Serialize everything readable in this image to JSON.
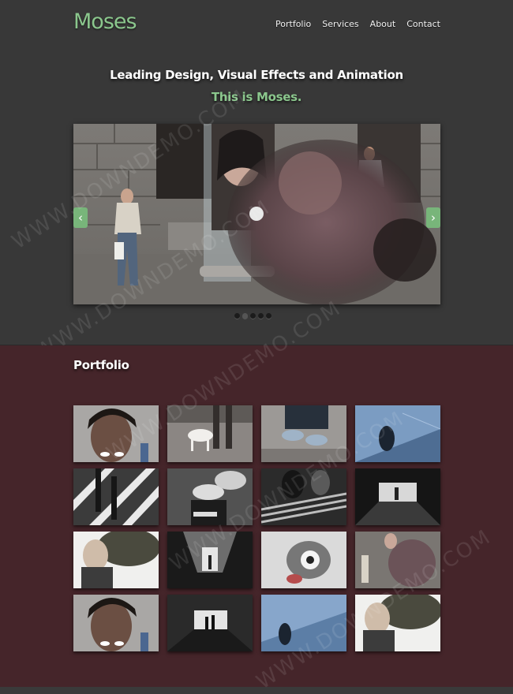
{
  "header": {
    "logo": "Moses",
    "nav": [
      "Portfolio",
      "Services",
      "About",
      "Contact"
    ]
  },
  "hero": {
    "headline": "Leading Design, Visual Effects and Animation",
    "tagline": "This is Moses."
  },
  "slider": {
    "prev_glyph": "‹",
    "next_glyph": "›",
    "dot_count": 5,
    "active_dot": 1
  },
  "portfolio": {
    "title": "Portfolio",
    "items": [
      "portrait-face",
      "legs-dog",
      "shoes-street",
      "blue-tunnel",
      "crosswalk-legs",
      "hand-cup",
      "stairs-crowd",
      "dark-tunnel",
      "tree-woman",
      "light-corridor",
      "badge-hand",
      "street-blur",
      "portrait-face",
      "station-silhouette",
      "blue-figure",
      "tree-woman"
    ]
  },
  "watermark": "WWW.DOWNDEMO.COM",
  "colors": {
    "accent": "#8bc78d",
    "top_bg": "#383838",
    "portfolio_bg": "#45252a"
  }
}
